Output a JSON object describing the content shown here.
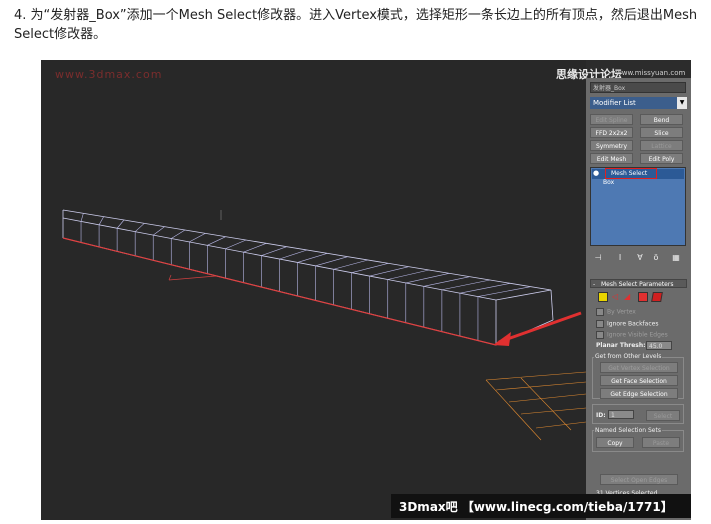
{
  "caption": "4. 为“发射器_Box”添加一个Mesh Select修改器。进入Vertex模式，选择矩形一条长边上的所有顶点，然后退出Mesh Select修改器。",
  "watermark_left": "www.3dmax.com",
  "watermark_right": "思缘设计论坛",
  "watermark_right_sub": "www.missyuan.com",
  "bottom_banner": "3Dmax吧 【www.linecg.com/tieba/1771】",
  "panel": {
    "object_name": "发射器_Box",
    "modifier_list": "Modifier List",
    "buttons": [
      {
        "label": "Edit Spline",
        "enabled": false
      },
      {
        "label": "Bend",
        "enabled": true
      },
      {
        "label": "FFD 2x2x2",
        "enabled": true
      },
      {
        "label": "Slice",
        "enabled": true
      },
      {
        "label": "Symmetry",
        "enabled": true
      },
      {
        "label": "Lattice",
        "enabled": false
      },
      {
        "label": "Edit Mesh",
        "enabled": true
      },
      {
        "label": "Edit Poly",
        "enabled": true
      }
    ],
    "stack": [
      "Mesh Select",
      "Box"
    ],
    "rollout_title": "Mesh Select Parameters",
    "by_vertex": "By Vertex",
    "ignore_backfaces": "Ignore Backfaces",
    "ignore_visible_edges": "Ignore Visible Edges",
    "planar_thresh_label": "Planar Thresh:",
    "planar_thresh_value": "45.0",
    "get_from_other_levels": "Get from Other Levels",
    "get_vertex_selection": "Get Vertex Selection",
    "get_face_selection": "Get Face Selection",
    "get_edge_selection": "Get Edge Selection",
    "id_label": "ID:",
    "id_value": "1",
    "select_button": "Select",
    "named_selection_sets": "Named Selection Sets",
    "copy": "Copy",
    "paste": "Paste",
    "select_open_edges": "Select Open Edges",
    "status": "31 Vertices Selected"
  }
}
